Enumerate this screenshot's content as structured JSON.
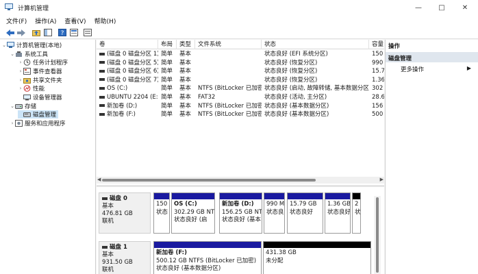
{
  "window": {
    "title": "计算机管理"
  },
  "menu": [
    "文件(F)",
    "操作(A)",
    "查看(V)",
    "帮助(H)"
  ],
  "tree": [
    {
      "label": "计算机管理(本地)",
      "level": 0,
      "expander": "⌄",
      "icon": "computer-icon"
    },
    {
      "label": "系统工具",
      "level": 1,
      "expander": "⌄",
      "icon": "tools-icon"
    },
    {
      "label": "任务计划程序",
      "level": 2,
      "expander": "›",
      "icon": "clock-icon"
    },
    {
      "label": "事件查看器",
      "level": 2,
      "expander": "›",
      "icon": "event-viewer-icon"
    },
    {
      "label": "共享文件夹",
      "level": 2,
      "expander": "›",
      "icon": "shared-folder-icon"
    },
    {
      "label": "性能",
      "level": 2,
      "expander": "›",
      "icon": "performance-icon"
    },
    {
      "label": "设备管理器",
      "level": 2,
      "expander": "",
      "icon": "device-manager-icon"
    },
    {
      "label": "存储",
      "level": 1,
      "expander": "⌄",
      "icon": "storage-icon"
    },
    {
      "label": "磁盘管理",
      "level": 2,
      "expander": "",
      "icon": "disk-management-icon",
      "selected": true
    },
    {
      "label": "服务和应用程序",
      "level": 1,
      "expander": "›",
      "icon": "services-icon"
    }
  ],
  "grid": {
    "columns": [
      "卷",
      "布局",
      "类型",
      "文件系统",
      "状态",
      "容量"
    ],
    "rows": [
      [
        "(磁盘 0 磁盘分区 1)",
        "简单",
        "基本",
        "",
        "状态良好 (EFI 系统分区)",
        "150"
      ],
      [
        "(磁盘 0 磁盘分区 5)",
        "简单",
        "基本",
        "",
        "状态良好 (恢复分区)",
        "990"
      ],
      [
        "(磁盘 0 磁盘分区 6)",
        "简单",
        "基本",
        "",
        "状态良好 (恢复分区)",
        "15.7"
      ],
      [
        "(磁盘 0 磁盘分区 7)",
        "简单",
        "基本",
        "",
        "状态良好 (恢复分区)",
        "1.36"
      ],
      [
        "OS (C:)",
        "简单",
        "基本",
        "NTFS (BitLocker 已加密)",
        "状态良好 (启动, 故障转储, 基本数据分区)",
        "302"
      ],
      [
        "UBUNTU 2204 (E:)",
        "简单",
        "基本",
        "FAT32",
        "状态良好 (活动, 主分区)",
        "28.6"
      ],
      [
        "新加卷 (D:)",
        "简单",
        "基本",
        "NTFS (BitLocker 已加密)",
        "状态良好 (基本数据分区)",
        "156"
      ],
      [
        "新加卷 (F:)",
        "简单",
        "基本",
        "NTFS (BitLocker 已加密)",
        "状态良好 (基本数据分区)",
        "500"
      ]
    ]
  },
  "disks": [
    {
      "name": "磁盘 0",
      "type": "基本",
      "size": "476.81 GB",
      "status": "联机",
      "partitions": [
        {
          "title": "",
          "line1": "150",
          "line2": "状态",
          "bar": "blue"
        },
        {
          "title": "OS (C:)",
          "line1": "302.29 GB NTFS",
          "line2": "状态良好 (启",
          "bar": "blue"
        },
        {
          "title": "新加卷 (D:)",
          "line1": "156.25 GB NTFS",
          "line2": "状态良好 (基本",
          "bar": "blue"
        },
        {
          "title": "",
          "line1": "990 M",
          "line2": "状态良",
          "bar": "blue"
        },
        {
          "title": "",
          "line1": "15.79 GB",
          "line2": "状态良好",
          "bar": "blue"
        },
        {
          "title": "",
          "line1": "1.36 GB",
          "line2": "状态良好",
          "bar": "blue"
        },
        {
          "title": "",
          "line1": "2",
          "line2": "状",
          "bar": "black"
        }
      ]
    },
    {
      "name": "磁盘 1",
      "type": "基本",
      "size": "931.50 GB",
      "status": "联机",
      "partitions": [
        {
          "title": "新加卷 (F:)",
          "line1": "500.12 GB NTFS (BitLocker 已加密)",
          "line2": "状态良好 (基本数据分区)",
          "bar": "blue"
        },
        {
          "title": "",
          "line1": "431.38 GB",
          "line2": "未分配",
          "bar": "black"
        }
      ]
    }
  ],
  "actions": {
    "header": "操作",
    "section": "磁盘管理",
    "more": "更多操作"
  }
}
